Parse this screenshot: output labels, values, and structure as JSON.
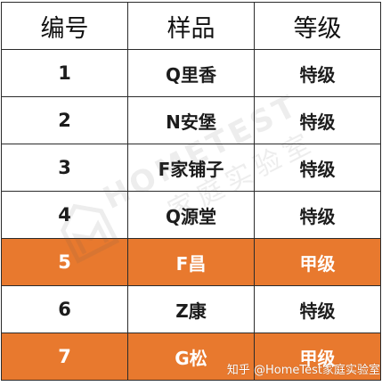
{
  "table": {
    "headers": [
      "编号",
      "样品",
      "等级"
    ],
    "rows": [
      {
        "no": "1",
        "sample": "Q里香",
        "grade": "特级",
        "highlight": false
      },
      {
        "no": "2",
        "sample": "N安堡",
        "grade": "特级",
        "highlight": false
      },
      {
        "no": "3",
        "sample": "F家铺子",
        "grade": "特级",
        "highlight": false
      },
      {
        "no": "4",
        "sample": "Q源堂",
        "grade": "特级",
        "highlight": false
      },
      {
        "no": "5",
        "sample": "F昌",
        "grade": "甲级",
        "highlight": true
      },
      {
        "no": "6",
        "sample": "Z康",
        "grade": "特级",
        "highlight": false
      },
      {
        "no": "7",
        "sample": "G松",
        "grade": "甲级",
        "highlight": true
      }
    ],
    "highlight_color": "#e8792e"
  },
  "watermark": {
    "brand": "HOMETEST",
    "sub": "家庭实验室"
  },
  "credit": "知乎 @HomeTest家庭实验室"
}
